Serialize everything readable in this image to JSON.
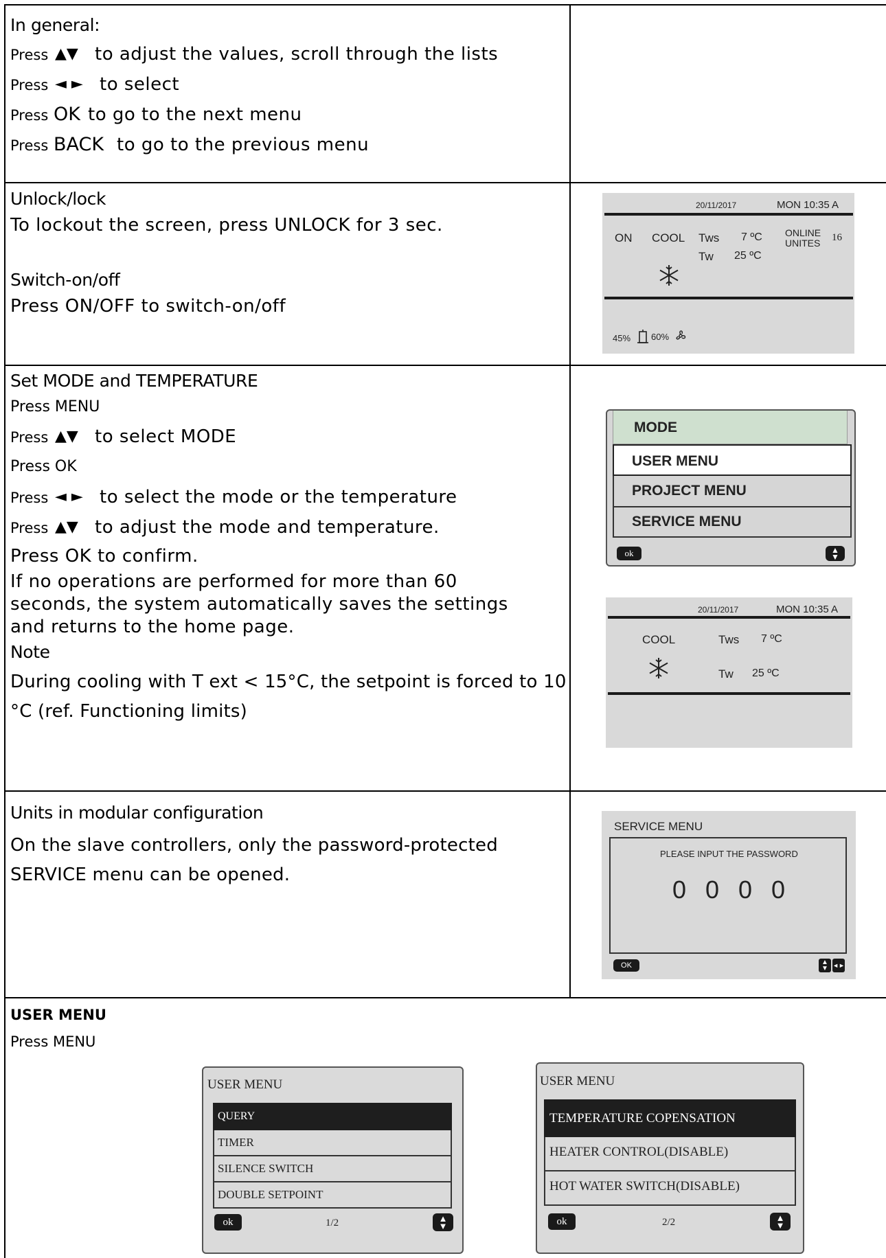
{
  "general": {
    "heading": "In general:",
    "line1_press": "Press",
    "line1_arrows": "▲▼",
    "line1_text": "to adjust the values, scroll through the lists",
    "line2_press": "Press",
    "line2_arrows": "◄ ►",
    "line2_text": "to select",
    "line3_press": "Press",
    "line3_key": "OK",
    "line3_text": "to go to the next menu",
    "line4_press": "Press",
    "line4_key": "BACK",
    "line4_text": "to go to the previous menu"
  },
  "lock": {
    "heading": "Unlock/lock",
    "text": "To lockout the screen, press UNLOCK for 3 sec.",
    "switch_heading": "Switch-on/off",
    "switch_text": "Press ON/OFF to switch-on/off"
  },
  "home_screen": {
    "date": "20/11/2017",
    "time": "MON 10:35 A",
    "status": "ON",
    "mode": "COOL",
    "tws_label": "Tws",
    "tws_value": "7 ºC",
    "tw_label": "Tw",
    "tw_value": "25 ºC",
    "online_line1": "ONLINE",
    "online_line2": "UNITES",
    "online_count": "16",
    "pct1": "45%",
    "pct2": "60%"
  },
  "mode_section": {
    "heading": "Set MODE and TEMPERATURE",
    "l1": "Press MENU",
    "l2_press": "Press",
    "l2_arrows": "▲▼",
    "l2_text": "to select MODE",
    "l3": "Press OK",
    "l4_press": "Press",
    "l4_arrows": "◄ ►",
    "l4_text": "to select the mode or the temperature",
    "l5_press": "Press",
    "l5_arrows": "▲▼",
    "l5_text": "to adjust the mode and temperature.",
    "l6": "Press OK to confirm.",
    "para": "If no operations are performed for more than 60 seconds, the system automatically saves the settings and returns to the home page.",
    "note_heading": "Note",
    "note_text": "During cooling with T ext < 15°C, the setpoint is forced to 10 °C (ref. Functioning limits)"
  },
  "main_menu_screen": {
    "items": [
      "MODE",
      "USER MENU",
      "PROJECT MENU",
      "SERVICE MENU"
    ],
    "ok_label": "ok"
  },
  "cool_screen": {
    "date": "20/11/2017",
    "time": "MON 10:35 A",
    "mode": "COOL",
    "tws_label": "Tws",
    "tws_value": "7 ºC",
    "tw_label": "Tw",
    "tw_value": "25 ºC"
  },
  "modular": {
    "heading": "Units in modular configuration",
    "text": "On the slave controllers, only the password-protected SERVICE menu can be opened."
  },
  "service_screen": {
    "title": "SERVICE MENU",
    "prompt": "PLEASE INPUT THE PASSWORD",
    "digits": [
      "0",
      "0",
      "0",
      "0"
    ],
    "ok_label": "OK"
  },
  "user_menu": {
    "heading": "USER MENU",
    "sub": "Press MENU",
    "screen1": {
      "title": "USER MENU",
      "items": [
        "QUERY",
        "TIMER",
        "SILENCE SWITCH",
        "DOUBLE SETPOINT"
      ],
      "ok_label": "ok",
      "page": "1/2"
    },
    "screen2": {
      "title": "USER MENU",
      "items": [
        "TEMPERATURE COPENSATION",
        "HEATER CONTROL(DISABLE)",
        "HOT WATER SWITCH(DISABLE)"
      ],
      "ok_label": "ok",
      "page": "2/2"
    }
  }
}
